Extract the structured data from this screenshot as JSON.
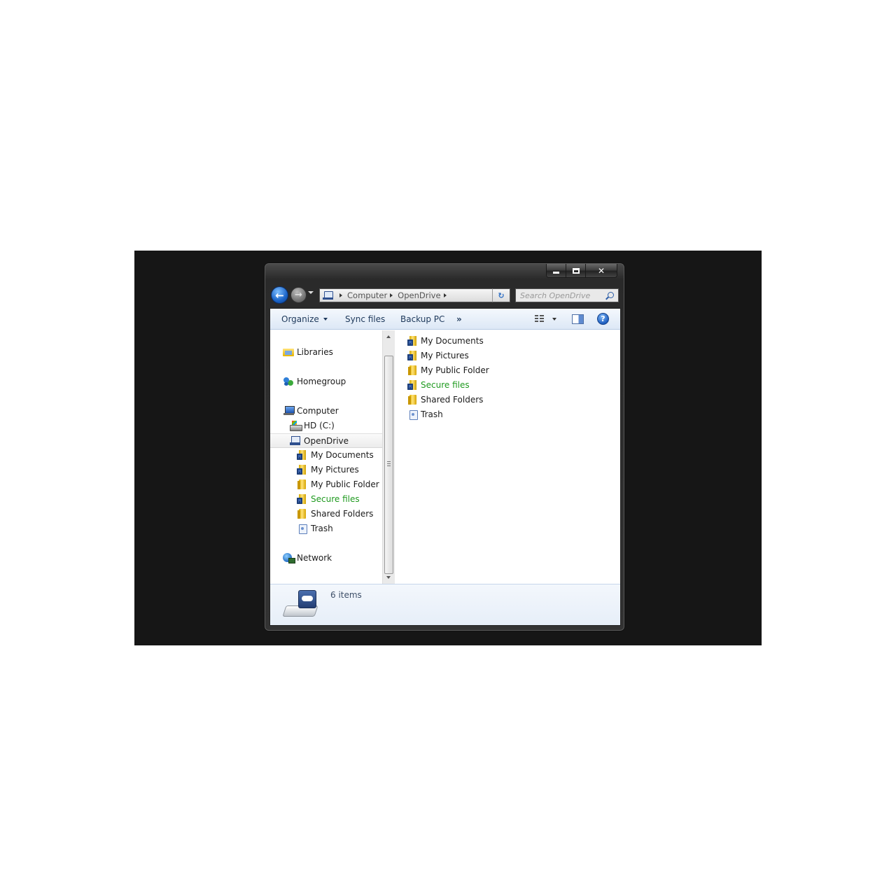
{
  "window": {
    "caption_buttons": {
      "minimize": "minimize-icon",
      "maximize": "maximize-icon",
      "close": "✕"
    }
  },
  "nav": {
    "back_icon": "back-arrow-icon",
    "forward_icon": "forward-arrow-icon",
    "breadcrumb": [
      "Computer",
      "OpenDrive"
    ],
    "search_placeholder": "Search OpenDrive"
  },
  "toolbar": {
    "organize": "Organize",
    "sync_files": "Sync files",
    "backup_pc": "Backup PC",
    "more": "»",
    "help": "?"
  },
  "navpane": {
    "libraries": "Libraries",
    "homegroup": "Homegroup",
    "computer": "Computer",
    "hd": "HD (C:)",
    "opendrive": "OpenDrive",
    "children": [
      {
        "label": "My Documents",
        "icon": "locked-folder-icon"
      },
      {
        "label": "My Pictures",
        "icon": "locked-folder-icon"
      },
      {
        "label": "My Public Folder",
        "icon": "folder-icon"
      },
      {
        "label": "Secure files",
        "icon": "locked-folder-icon",
        "color": "#1f9a1f"
      },
      {
        "label": "Shared Folders",
        "icon": "folder-icon"
      },
      {
        "label": "Trash",
        "icon": "trash-icon"
      }
    ],
    "network": "Network"
  },
  "content": {
    "items": [
      {
        "label": "My Documents",
        "icon": "locked-folder-icon"
      },
      {
        "label": "My Pictures",
        "icon": "locked-folder-icon"
      },
      {
        "label": "My Public Folder",
        "icon": "folder-icon"
      },
      {
        "label": "Secure files",
        "icon": "locked-folder-icon",
        "color": "#1f9a1f"
      },
      {
        "label": "Shared Folders",
        "icon": "folder-icon"
      },
      {
        "label": "Trash",
        "icon": "trash-icon"
      }
    ]
  },
  "details": {
    "item_count": "6 items"
  }
}
